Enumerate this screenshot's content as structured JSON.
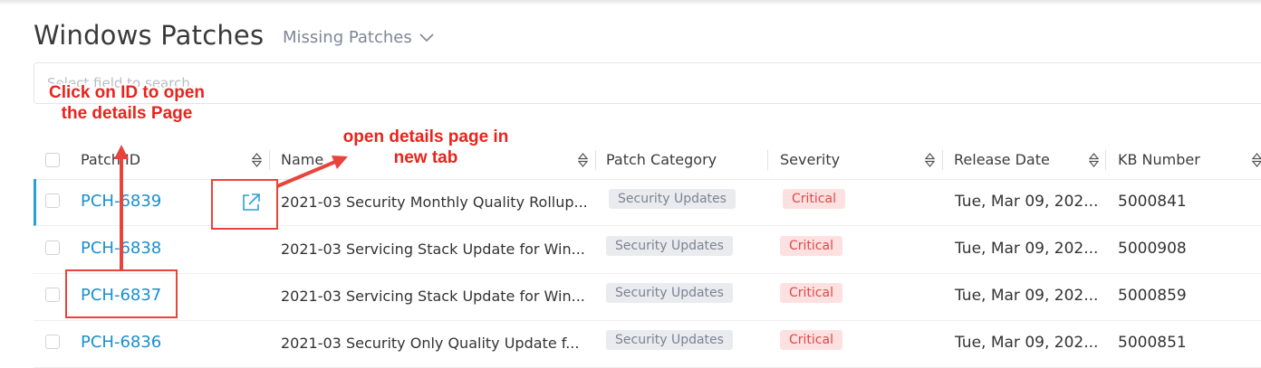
{
  "header": {
    "title": "Windows Patches",
    "view_selector": "Missing Patches"
  },
  "search": {
    "placeholder": "Select field to search..."
  },
  "table": {
    "columns": [
      "Patch ID",
      "Name",
      "Patch Category",
      "Severity",
      "Release Date",
      "KB Number"
    ],
    "rows": [
      {
        "id": "PCH-6839",
        "name": "2021-03 Security Monthly Quality Rollup...",
        "category": "Security Updates",
        "severity": "Critical",
        "release_date": "Tue, Mar 09, 202...",
        "kb": "5000841"
      },
      {
        "id": "PCH-6838",
        "name": "2021-03 Servicing Stack Update for Win...",
        "category": "Security Updates",
        "severity": "Critical",
        "release_date": "Tue, Mar 09, 202...",
        "kb": "5000908"
      },
      {
        "id": "PCH-6837",
        "name": "2021-03 Servicing Stack Update for Win...",
        "category": "Security Updates",
        "severity": "Critical",
        "release_date": "Tue, Mar 09, 202...",
        "kb": "5000859"
      },
      {
        "id": "PCH-6836",
        "name": "2021-03 Security Only Quality Update f...",
        "category": "Security Updates",
        "severity": "Critical",
        "release_date": "Tue, Mar 09, 202...",
        "kb": "5000851"
      }
    ]
  },
  "annotations": {
    "click_id": "Click on ID to open the details Page",
    "new_tab": "open details page in new tab"
  },
  "colors": {
    "link": "#1a8fcf",
    "annotation": "#e8231c",
    "critical_bg": "#fde1e1",
    "critical_text": "#e04848",
    "category_bg": "#e9ebef"
  }
}
